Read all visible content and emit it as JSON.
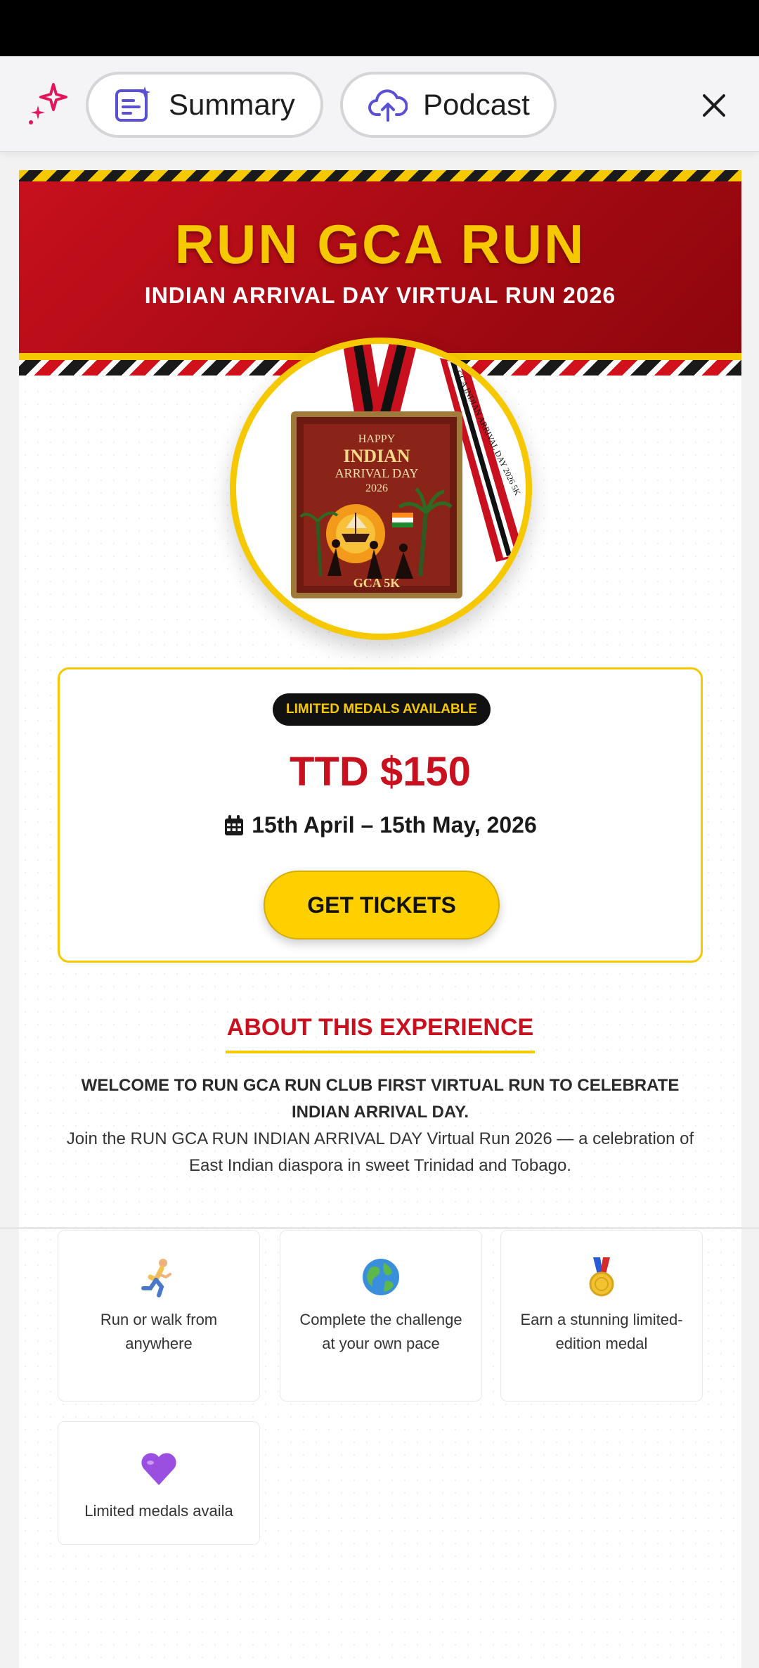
{
  "toolbar": {
    "summary_label": "Summary",
    "podcast_label": "Podcast",
    "accent": "#5b4fd6"
  },
  "hero": {
    "title": "RUN GCA RUN",
    "subtitle": "INDIAN ARRIVAL DAY VIRTUAL RUN 2026",
    "bg_color": "#c8101e",
    "title_color": "#f5c800"
  },
  "medal": {
    "line1": "HAPPY",
    "line2": "INDIAN",
    "line3": "ARRIVAL DAY",
    "line4": "2026",
    "footer": "GCA 5K",
    "ribbon_text": "GCA INDIAN ARRIVAL DAY 2026 5K"
  },
  "tickets": {
    "badge": "LIMITED MEDALS AVAILABLE",
    "price": "TTD $150",
    "dates": "15th April – 15th May, 2026",
    "cta": "GET TICKETS"
  },
  "about": {
    "title": "ABOUT THIS EXPERIENCE",
    "welcome": "WELCOME TO RUN GCA RUN CLUB FIRST VIRTUAL RUN TO CELEBRATE INDIAN ARRIVAL DAY.",
    "description": "Join the RUN GCA RUN INDIAN ARRIVAL DAY Virtual Run 2026 — a celebration of East Indian diaspora in sweet Trinidad and Tobago."
  },
  "features": [
    {
      "icon": "runner-icon",
      "text": "Run or walk from anywhere"
    },
    {
      "icon": "globe-icon",
      "text": "Complete the challenge at your own pace"
    },
    {
      "icon": "medal-icon",
      "text": "Earn a stunning limited-edition medal"
    },
    {
      "icon": "purple-heart-icon",
      "text": "Limited medals availa"
    }
  ]
}
